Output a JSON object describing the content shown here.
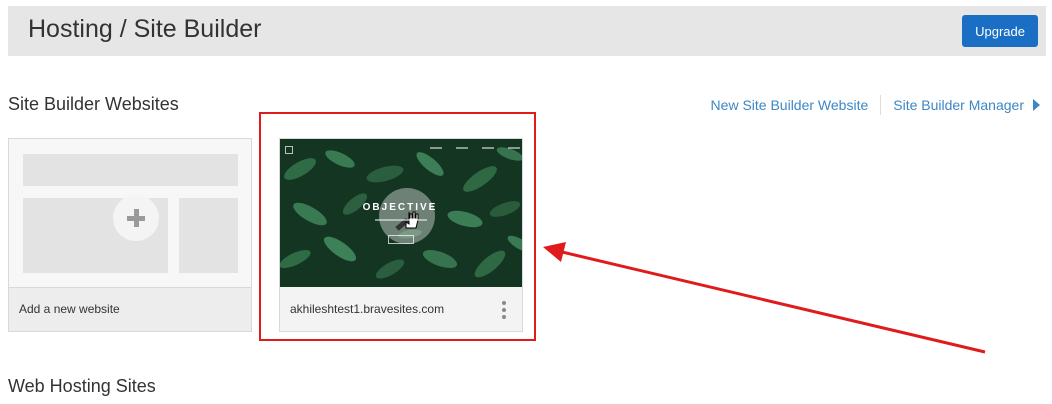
{
  "header": {
    "title": "Hosting / Site Builder",
    "upgrade_label": "Upgrade"
  },
  "site_builder": {
    "section_title": "Site Builder Websites",
    "links": {
      "new_website": "New Site Builder Website",
      "manager": "Site Builder Manager"
    },
    "cards": [
      {
        "label": "Add a new website",
        "icon": "plus-icon"
      },
      {
        "label": "akhileshtest1.bravesites.com",
        "thumbnail_text": "OBJECTIVE",
        "overlay_icon": "edit-pencil-icon",
        "menu_icon": "kebab-menu-icon"
      }
    ]
  },
  "web_hosting": {
    "section_title": "Web Hosting Sites"
  },
  "annotation": {
    "highlight_color": "#e01b1b"
  },
  "colors": {
    "accent": "#1a6fc4",
    "link": "#3d87c4"
  }
}
